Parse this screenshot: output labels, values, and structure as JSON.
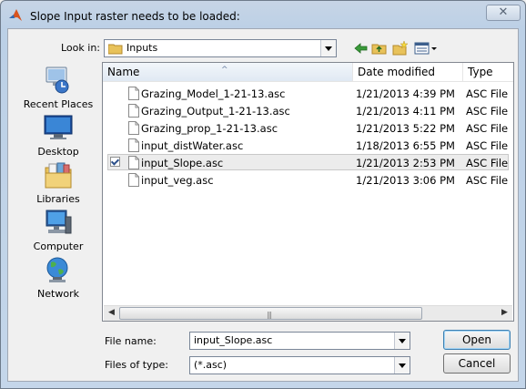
{
  "window": {
    "title": "Slope Input raster needs to be loaded:",
    "close_label": "✕"
  },
  "lookin": {
    "label": "Look in:",
    "value": "Inputs"
  },
  "places": [
    {
      "label": "Recent Places",
      "icon": "recent-places-icon"
    },
    {
      "label": "Desktop",
      "icon": "desktop-icon"
    },
    {
      "label": "Libraries",
      "icon": "libraries-icon"
    },
    {
      "label": "Computer",
      "icon": "computer-icon"
    },
    {
      "label": "Network",
      "icon": "network-icon"
    }
  ],
  "columns": {
    "name": "Name",
    "date": "Date modified",
    "type": "Type"
  },
  "files": [
    {
      "name": "Grazing_Model_1-21-13.asc",
      "date": "1/21/2013 4:39 PM",
      "type": "ASC File",
      "selected": false
    },
    {
      "name": "Grazing_Output_1-21-13.asc",
      "date": "1/21/2013 4:11 PM",
      "type": "ASC File",
      "selected": false
    },
    {
      "name": "Grazing_prop_1-21-13.asc",
      "date": "1/21/2013 5:22 PM",
      "type": "ASC File",
      "selected": false
    },
    {
      "name": "input_distWater.asc",
      "date": "1/18/2013 6:55 PM",
      "type": "ASC File",
      "selected": false
    },
    {
      "name": "input_Slope.asc",
      "date": "1/21/2013 2:53 PM",
      "type": "ASC File",
      "selected": true
    },
    {
      "name": "input_veg.asc",
      "date": "1/21/2013 3:06 PM",
      "type": "ASC File",
      "selected": false
    }
  ],
  "filename": {
    "label": "File name:",
    "value": "input_Slope.asc"
  },
  "filetype": {
    "label": "Files of type:",
    "value": "(*.asc)"
  },
  "buttons": {
    "open": "Open",
    "cancel": "Cancel"
  },
  "scroll": {
    "left_arrow": "◀",
    "right_arrow": "▶",
    "grip": "|||"
  },
  "colors": {
    "folder": "#e8c25a",
    "accent": "#3c7fb1"
  }
}
